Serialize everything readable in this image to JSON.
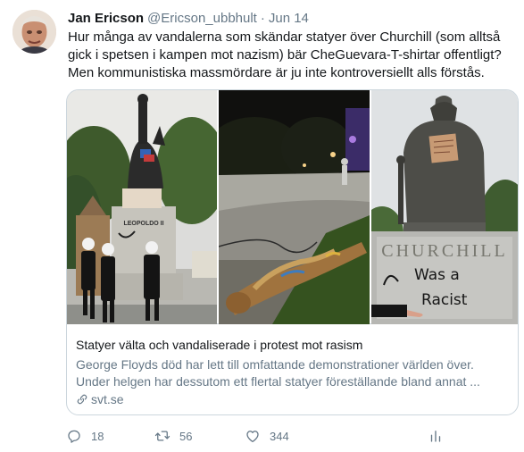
{
  "tweet": {
    "author_name": "Jan Ericson",
    "author_handle": "@Ericson_ubbhult",
    "separator": "·",
    "time": "Jun 14",
    "text": "Hur många av vandalerna som skändar statyer över Churchill (som alltså gick i spetsen i kampen mot nazism) bär CheGuevara-T-shirtar offentligt? Men kommunistiska massmördare är ju inte kontroversiellt alls förstås."
  },
  "card": {
    "title": "Statyer välta och vandaliserade i protest mot rasism",
    "description": "George Floyds död har lett till omfattande demonstrationer världen över. Under helgen har dessutom ett flertal statyer föreställande bland annat ...",
    "domain": "svt.se",
    "images": {
      "statue1_plaque": "LEOPOLDO II",
      "statue3_plinth": "CHURCHILL",
      "graffiti_line1": "Was a",
      "graffiti_line2": "Racist"
    }
  },
  "actions": {
    "replies": "18",
    "retweets": "56",
    "likes": "344"
  },
  "icons": {
    "reply": "reply-icon",
    "retweet": "retweet-icon",
    "like": "heart-icon",
    "stats": "analytics-icon",
    "link": "link-icon"
  },
  "colors": {
    "text": "#14171a",
    "secondary": "#657786",
    "border": "#ccd6dd"
  }
}
